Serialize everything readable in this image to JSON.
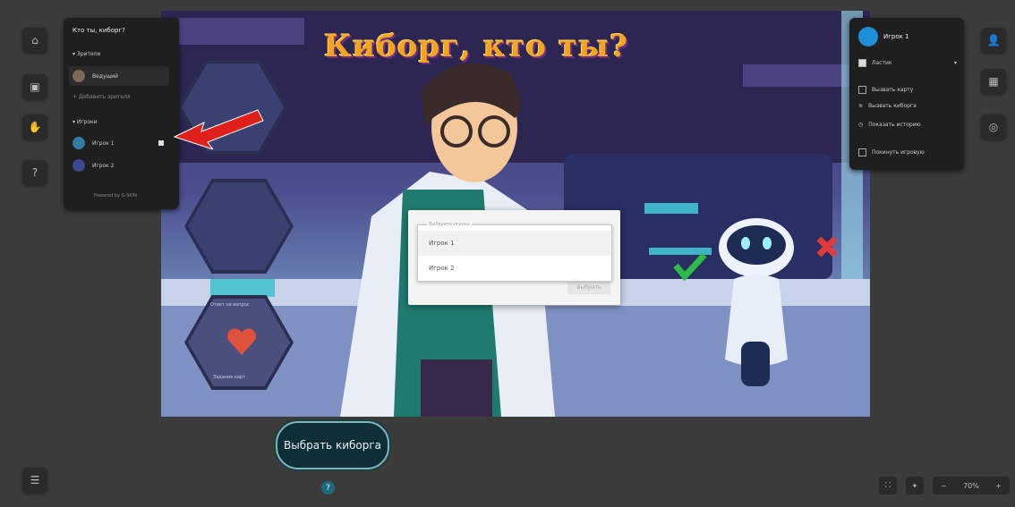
{
  "left_panel": {
    "title": "Кто ты, киборг?",
    "section_spectators": "Зрители",
    "spectator_name": "Ведущий",
    "add_spectator": "+ Добавить зрителя",
    "section_players": "Игроки",
    "players": [
      "Игрок 1",
      "Игрок 2"
    ],
    "powered_by": "Powered by G-SKIN"
  },
  "right_panel": {
    "user_name": "Игрок 1",
    "options_label": "Ластик",
    "menu": [
      "Вызвать карту",
      "Вызвать киборга",
      "Показать историю",
      "Покинуть игровую"
    ]
  },
  "board": {
    "title": "Киборг, кто ты?",
    "hex_labels": [
      "Ответ на вопрос",
      "Задание карт"
    ]
  },
  "dialog": {
    "select_label": "Выберите игрока",
    "options": [
      "Игрок 1",
      "Игрок 2"
    ],
    "confirm_button": "Выбрать"
  },
  "actions": {
    "choose_cyborg_button": "Выбрать киборга",
    "help_label": "?"
  },
  "zoom": {
    "minus": "−",
    "value": "70%",
    "plus": "+"
  },
  "colors": {
    "app_bg": "#3b3b3b",
    "panel_bg": "#1f1f1f",
    "accent": "#1d6b80",
    "title_orange": "#f3a51c",
    "arrow_red": "#e0201b"
  }
}
